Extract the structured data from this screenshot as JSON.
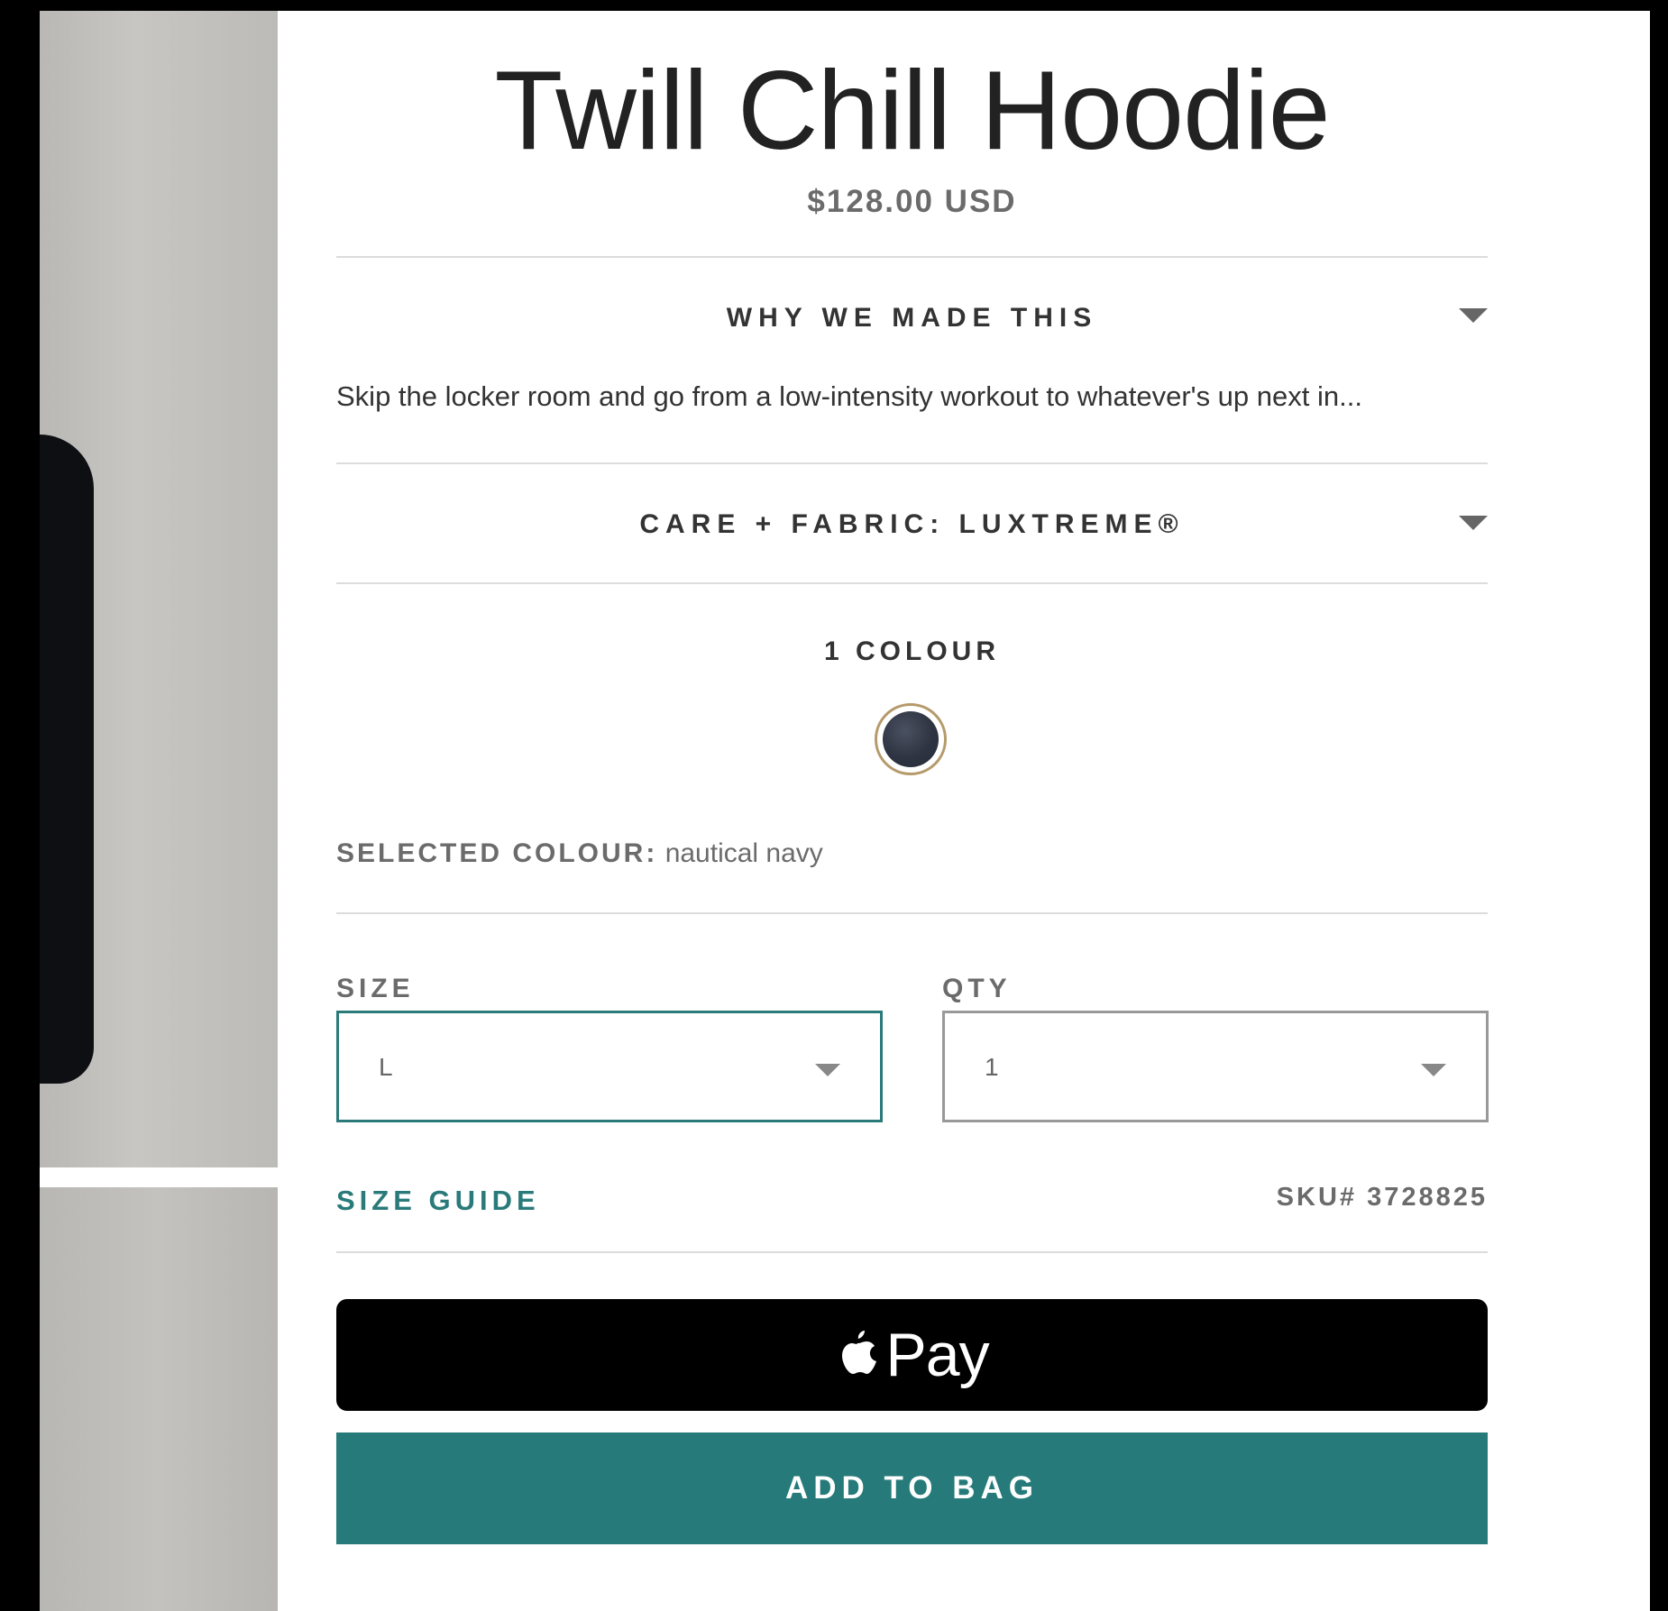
{
  "product": {
    "title": "Twill Chill Hoodie",
    "price": "$128.00 USD"
  },
  "accordions": [
    {
      "title": "WHY WE MADE THIS",
      "description": "Skip the locker room and go from a low-intensity workout to whatever's up next in..."
    },
    {
      "title": "CARE + FABRIC: LUXTREME®"
    }
  ],
  "colour": {
    "count_label": "1 COLOUR",
    "selected_label": "SELECTED COLOUR:",
    "selected_value": "nautical navy",
    "swatch_color": "#2e3442",
    "swatch_ring_color": "#b59a6a"
  },
  "size": {
    "label": "SIZE",
    "value": "L"
  },
  "qty": {
    "label": "QTY",
    "value": "1"
  },
  "size_guide": "SIZE GUIDE",
  "sku": "SKU# 3728825",
  "apple_pay": {
    "icon": "apple-logo-icon",
    "label": "Pay"
  },
  "add_to_bag": "ADD TO BAG",
  "colors": {
    "accent": "#267a7a",
    "text": "#333333",
    "muted": "#6b6b6b"
  }
}
